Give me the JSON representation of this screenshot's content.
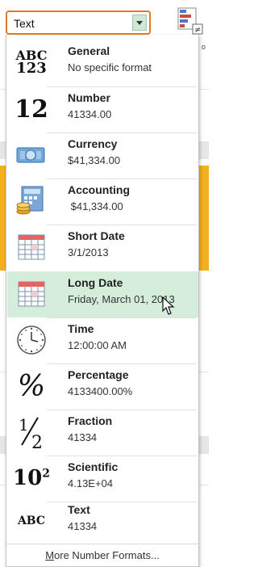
{
  "combo": {
    "value": "Text"
  },
  "ribbon": {
    "hint": "o"
  },
  "formats": [
    {
      "name": "General",
      "example": "No specific format",
      "icon": "abc-123-icon"
    },
    {
      "name": "Number",
      "example": "41334.00",
      "icon": "number-12-icon"
    },
    {
      "name": "Currency",
      "example": "$41,334.00",
      "icon": "currency-icon"
    },
    {
      "name": "Accounting",
      "example": " $41,334.00",
      "icon": "accounting-icon"
    },
    {
      "name": "Short Date",
      "example": "3/1/2013",
      "icon": "calendar-icon"
    },
    {
      "name": "Long Date",
      "example": "Friday, March 01, 2013",
      "icon": "calendar-icon"
    },
    {
      "name": "Time",
      "example": "12:00:00 AM",
      "icon": "clock-icon"
    },
    {
      "name": "Percentage",
      "example": "4133400.00%",
      "icon": "percent-icon"
    },
    {
      "name": "Fraction",
      "example": "41334",
      "icon": "fraction-icon"
    },
    {
      "name": "Scientific",
      "example": "4.13E+04",
      "icon": "scientific-icon"
    },
    {
      "name": "Text",
      "example": "41334",
      "icon": "abc-icon"
    }
  ],
  "glyphs": {
    "general_top": "ABC",
    "general_bottom": "123",
    "number": "12",
    "percent": "%",
    "fraction_num": "1",
    "fraction_den": "2",
    "sci_base": "10",
    "sci_exp": "2",
    "text": "ABC"
  },
  "more": {
    "prefix": "M",
    "rest": "ore Number Formats..."
  },
  "hovered_index": 5,
  "colors": {
    "accent_border": "#e07b24",
    "hover": "#d5eedb",
    "button": "#cfe8d6"
  }
}
